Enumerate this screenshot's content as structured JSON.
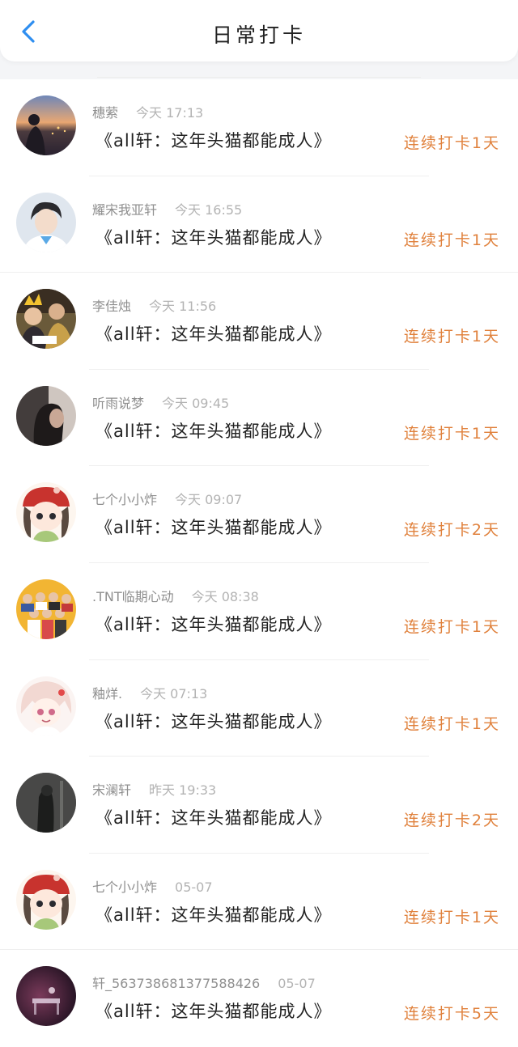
{
  "header": {
    "title": "日常打卡"
  },
  "colors": {
    "accent": "#e0813c",
    "back": "#2e8ef0"
  },
  "entries": [
    {
      "name": "穗萦",
      "time": "今天 17:13",
      "book": "《all轩：这年头猫都能成人》",
      "streak": "连续打卡1天",
      "avatar": "sunset-portrait"
    },
    {
      "name": "耀宋我亚轩",
      "time": "今天 16:55",
      "book": "《all轩：这年头猫都能成人》",
      "streak": "连续打卡1天",
      "avatar": "boy-portrait"
    },
    {
      "name": "李佳烛",
      "time": "今天 11:56",
      "book": "《all轩：这年头猫都能成人》",
      "streak": "连续打卡1天",
      "avatar": "birthday-photo"
    },
    {
      "name": "听雨说梦",
      "time": "今天 09:45",
      "book": "《all轩：这年头猫都能成人》",
      "streak": "连续打卡1天",
      "avatar": "girl-silhouette"
    },
    {
      "name": "七个小小炸",
      "time": "今天 09:07",
      "book": "《all轩：这年头猫都能成人》",
      "streak": "连续打卡2天",
      "avatar": "anime-girl-red-hat"
    },
    {
      "name": ".TNT临期心动",
      "time": "今天 08:38",
      "book": "《all轩：这年头猫都能成人》",
      "streak": "连续打卡1天",
      "avatar": "group-photo"
    },
    {
      "name": "釉烊.",
      "time": "今天 07:13",
      "book": "《all轩：这年头猫都能成人》",
      "streak": "连续打卡1天",
      "avatar": "anime-girl-pink"
    },
    {
      "name": "宋澜轩",
      "time": "昨天 19:33",
      "book": "《all轩：这年头猫都能成人》",
      "streak": "连续打卡2天",
      "avatar": "dark-photo"
    },
    {
      "name": "七个小小炸",
      "time": "05-07",
      "book": "《all轩：这年头猫都能成人》",
      "streak": "连续打卡1天",
      "avatar": "anime-girl-red-hat"
    },
    {
      "name": "轩_5637386813775884​26",
      "time": "05-07",
      "book": "《all轩：这年头猫都能成人》",
      "streak": "连续打卡5天",
      "avatar": "piano-night"
    }
  ]
}
